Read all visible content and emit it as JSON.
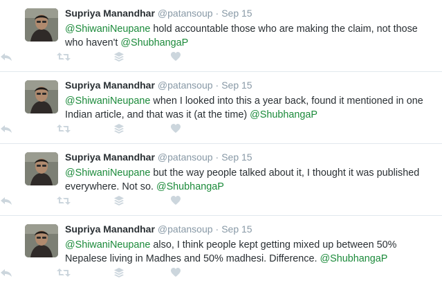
{
  "tweets": [
    {
      "name": "Supriya Manandhar",
      "handle": "@patansoup",
      "sep": "·",
      "time": "Sep 15",
      "mention_lead": "@ShiwaniNeupane",
      "body": " hold accountable those who are making the claim, not those who haven't ",
      "mention_tail": "@ShubhangaP"
    },
    {
      "name": "Supriya Manandhar",
      "handle": "@patansoup",
      "sep": "·",
      "time": "Sep 15",
      "mention_lead": "@ShiwaniNeupane",
      "body": " when I looked into this a year back, found it mentioned in one Indian article, and that was it (at the time) ",
      "mention_tail": "@ShubhangaP"
    },
    {
      "name": "Supriya Manandhar",
      "handle": "@patansoup",
      "sep": "·",
      "time": "Sep 15",
      "mention_lead": "@ShiwaniNeupane",
      "body": " but the way people talked about it, I thought it was published everywhere. Not so. ",
      "mention_tail": "@ShubhangaP"
    },
    {
      "name": "Supriya Manandhar",
      "handle": "@patansoup",
      "sep": "·",
      "time": "Sep 15",
      "mention_lead": "@ShiwaniNeupane",
      "body": " also, I think people kept getting mixed up between 50% Nepalese living in Madhes and 50% madhesi. Difference. ",
      "mention_tail": "@ShubhangaP"
    }
  ],
  "icons": [
    "reply-icon",
    "retweet-icon",
    "stack-icon",
    "heart-icon"
  ],
  "colors": {
    "mention": "#1b8a3a",
    "meta": "#8899a6",
    "icon": "#ccd6dd",
    "divider": "#e1e8ed"
  }
}
